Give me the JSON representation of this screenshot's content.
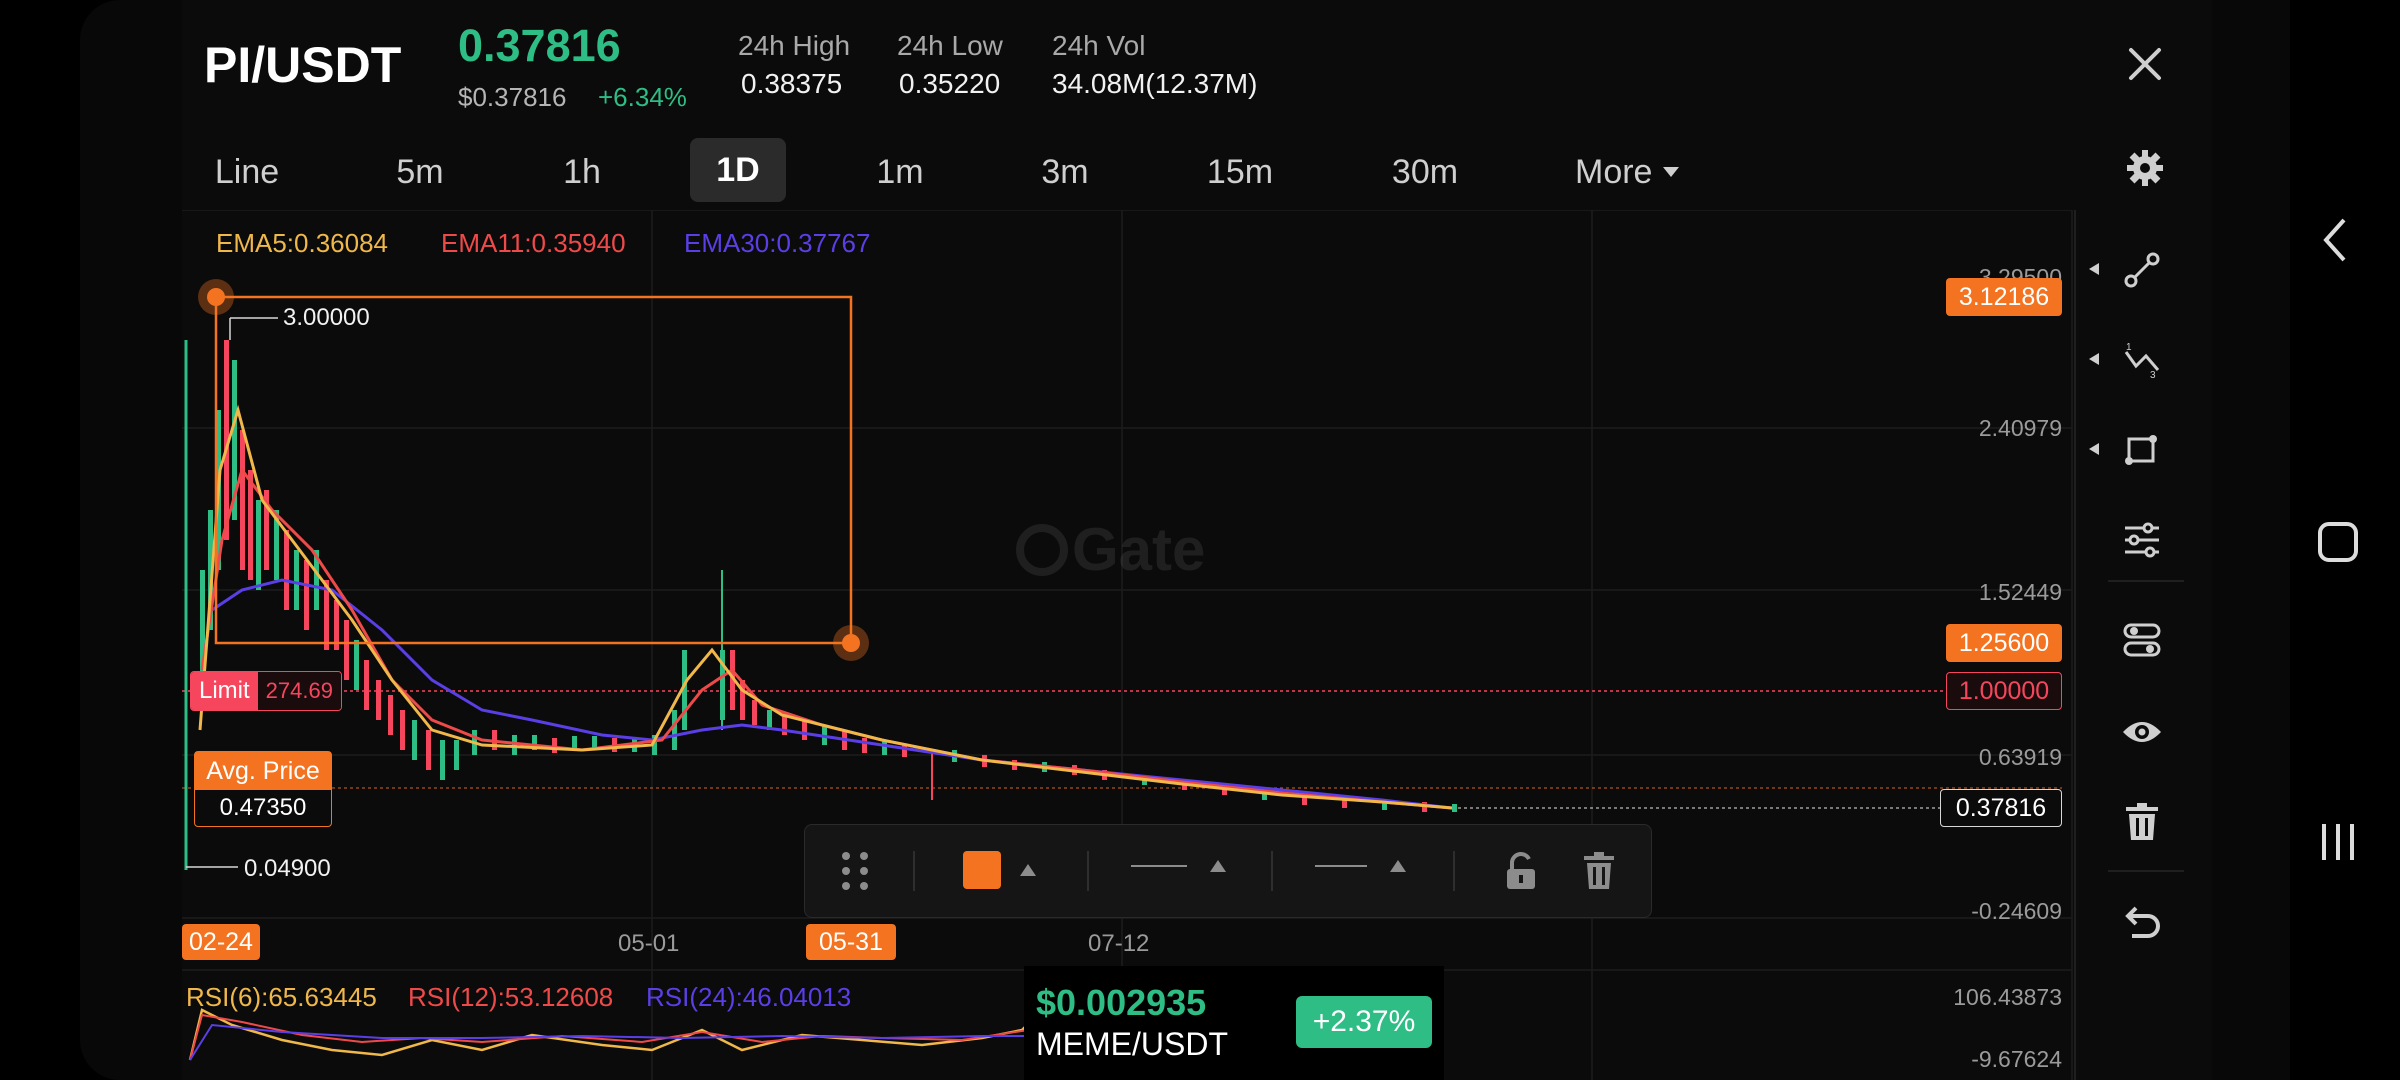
{
  "header": {
    "pair": "PI/USDT",
    "last_price": "0.37816",
    "usd_price": "$0.37816",
    "change": "+6.34%",
    "stats": [
      {
        "label": "24h High",
        "value": "0.38375"
      },
      {
        "label": "24h Low",
        "value": "0.35220"
      },
      {
        "label": "24h Vol",
        "value": "34.08M(12.37M)"
      }
    ]
  },
  "timeframes": [
    "Line",
    "5m",
    "1h",
    "1D",
    "1m",
    "3m",
    "15m",
    "30m",
    "More"
  ],
  "active_timeframe": "1D",
  "indicators": {
    "ema5": "EMA5:0.36084",
    "ema11": "EMA11:0.35940",
    "ema30": "EMA30:0.37767"
  },
  "chart": {
    "watermark": "Gate",
    "y_ticks": [
      "3.29500",
      "2.40979",
      "1.52449",
      "0.63919",
      "-0.24609"
    ],
    "x_ticks": [
      "02-24",
      "05-01",
      "05-31",
      "07-12"
    ],
    "price_labels": {
      "drawing_top": "3.12186",
      "drawing_bottom": "1.25600",
      "limit_line": "1.00000",
      "last": "0.37816"
    },
    "annotations": {
      "high": "3.00000",
      "low": "0.04900"
    },
    "limit_order": {
      "label": "Limit",
      "value": "274.69"
    },
    "avg_price": {
      "label": "Avg. Price",
      "value": "0.47350"
    }
  },
  "rsi": {
    "rsi6": "RSI(6):65.63445",
    "rsi12": "RSI(12):53.12608",
    "rsi24": "RSI(24):46.04013",
    "top": "106.43873",
    "bottom": "-9.67624"
  },
  "overlay": {
    "price": "$0.002935",
    "pair": "MEME/USDT",
    "change": "+2.37%"
  },
  "colors": {
    "up": "#2ebd85",
    "down": "#f6465d",
    "accent": "#f37320",
    "ema5": "#f0b74a",
    "ema11": "#ef4a4a",
    "ema30": "#5a3fe6"
  }
}
